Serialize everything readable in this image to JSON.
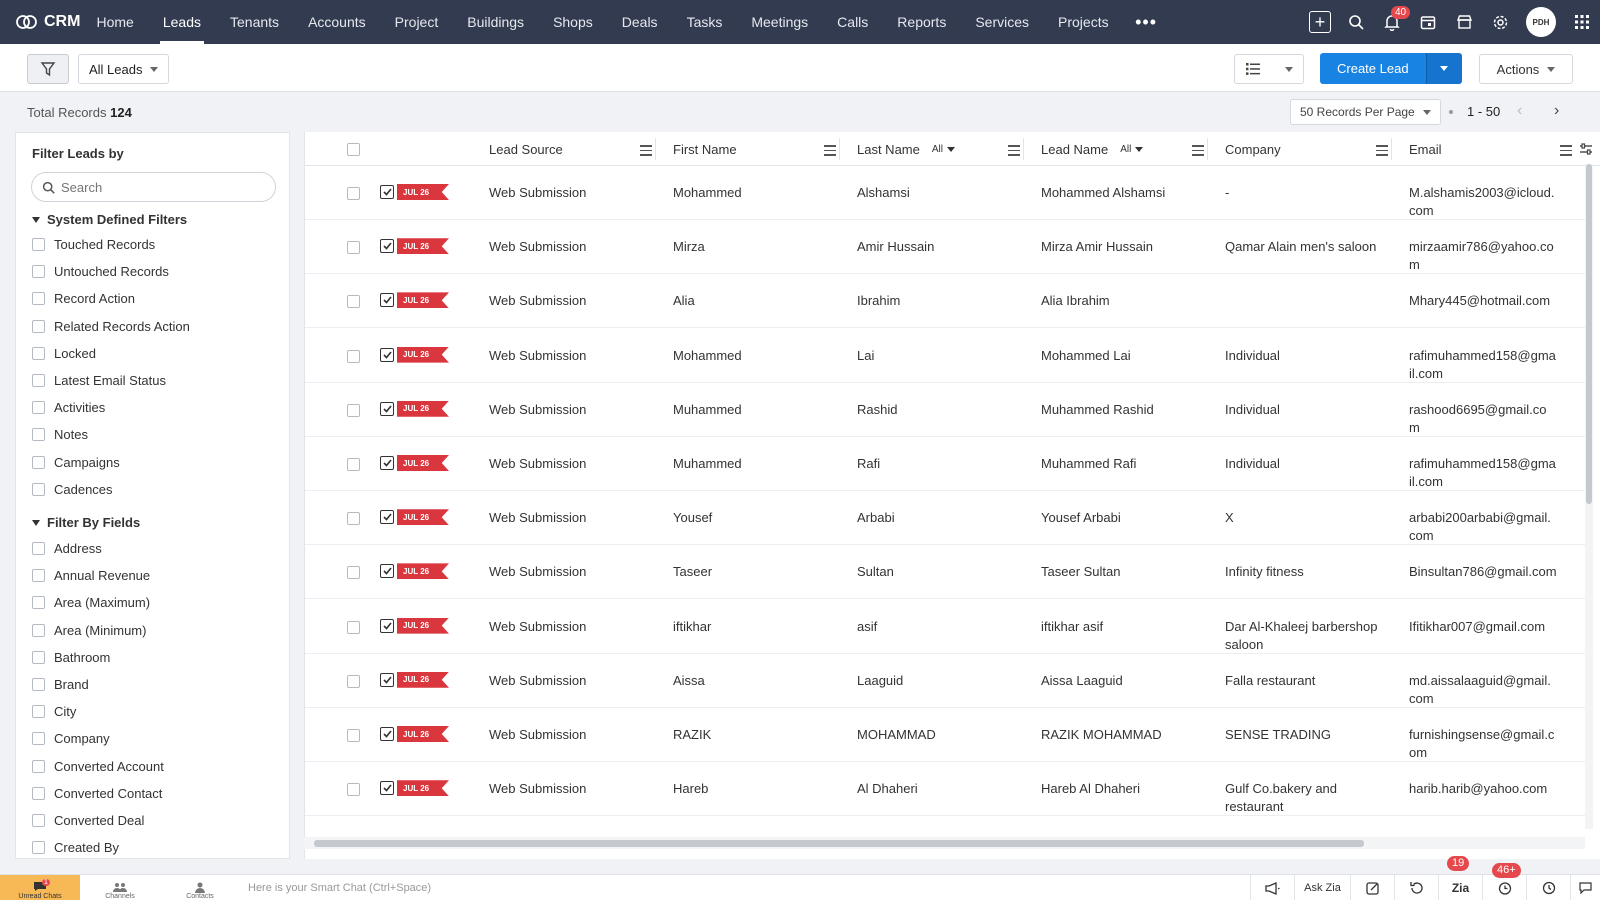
{
  "app": {
    "name": "CRM"
  },
  "nav": {
    "items": [
      "Home",
      "Leads",
      "Tenants",
      "Accounts",
      "Project",
      "Buildings",
      "Shops",
      "Deals",
      "Tasks",
      "Meetings",
      "Calls",
      "Reports",
      "Services",
      "Projects"
    ],
    "active": "Leads",
    "more": "•••",
    "notifications_count": "40",
    "avatar_text": "PDH"
  },
  "toolbar": {
    "view": "All Leads",
    "create_label": "Create Lead",
    "actions_label": "Actions"
  },
  "subbar": {
    "total_label": "Total Records",
    "total_count": "124",
    "per_page": "50 Records Per Page",
    "range": "1 - 50"
  },
  "sidebar": {
    "title": "Filter Leads by",
    "search_placeholder": "Search",
    "system_title": "System Defined Filters",
    "system_filters": [
      "Touched Records",
      "Untouched Records",
      "Record Action",
      "Related Records Action",
      "Locked",
      "Latest Email Status",
      "Activities",
      "Notes",
      "Campaigns",
      "Cadences"
    ],
    "fields_title": "Filter By Fields",
    "field_filters": [
      "Address",
      "Annual Revenue",
      "Area (Maximum)",
      "Area (Minimum)",
      "Bathroom",
      "Brand",
      "City",
      "Company",
      "Converted Account",
      "Converted Contact",
      "Converted Deal",
      "Created By"
    ]
  },
  "table": {
    "columns": {
      "lead_source": "Lead Source",
      "first_name": "First Name",
      "last_name": "Last Name",
      "lead_name": "Lead Name",
      "company": "Company",
      "email": "Email",
      "all_filter": "All"
    },
    "tag_label": "JUL 26",
    "rows": [
      {
        "source": "Web Submission",
        "first": "Mohammed",
        "last": "Alshamsi",
        "name": "Mohammed Alshamsi",
        "company": "-",
        "email": "M.alshamis2003@icloud.com"
      },
      {
        "source": "Web Submission",
        "first": "Mirza",
        "last": "Amir Hussain",
        "name": "Mirza Amir Hussain",
        "company": "Qamar Alain men's saloon",
        "email": "mirzaamir786@yahoo.com"
      },
      {
        "source": "Web Submission",
        "first": "Alia",
        "last": "Ibrahim",
        "name": "Alia Ibrahim",
        "company": "",
        "email": "Mhary445@hotmail.com"
      },
      {
        "source": "Web Submission",
        "first": "Mohammed",
        "last": "Lai",
        "name": "Mohammed Lai",
        "company": "Individual",
        "email": "rafimuhammed158@gmail.com"
      },
      {
        "source": "Web Submission",
        "first": "Muhammed",
        "last": "Rashid",
        "name": "Muhammed Rashid",
        "company": "Individual",
        "email": "rashood6695@gmail.com"
      },
      {
        "source": "Web Submission",
        "first": "Muhammed",
        "last": "Rafi",
        "name": "Muhammed Rafi",
        "company": "Individual",
        "email": "rafimuhammed158@gmail.com"
      },
      {
        "source": "Web Submission",
        "first": "Yousef",
        "last": "Arbabi",
        "name": "Yousef Arbabi",
        "company": "X",
        "email": "arbabi200arbabi@gmail.com"
      },
      {
        "source": "Web Submission",
        "first": "Taseer",
        "last": "Sultan",
        "name": "Taseer Sultan",
        "company": "Infinity fitness",
        "email": "Binsultan786@gmail.com"
      },
      {
        "source": "Web Submission",
        "first": "iftikhar",
        "last": "asif",
        "name": "iftikhar asif",
        "company": "Dar Al-Khaleej barbershop saloon",
        "email": "Ifitikhar007@gmail.com"
      },
      {
        "source": "Web Submission",
        "first": "Aissa",
        "last": "Laaguid",
        "name": "Aissa Laaguid",
        "company": "Falla restaurant",
        "email": "md.aissalaaguid@gmail.com"
      },
      {
        "source": "Web Submission",
        "first": "RAZIK",
        "last": "MOHAMMAD",
        "name": "RAZIK MOHAMMAD",
        "company": "SENSE TRADING",
        "email": "furnishingsense@gmail.com"
      },
      {
        "source": "Web Submission",
        "first": "Hareb",
        "last": "Al Dhaheri",
        "name": "Hareb Al Dhaheri",
        "company": "Gulf Co.bakery and restaurant",
        "email": "harib.harib@yahoo.com"
      }
    ]
  },
  "bottombar": {
    "unread_label": "Unread Chats",
    "unread_count": "1",
    "channels_label": "Channels",
    "contacts_label": "Contacts",
    "smart_chat": "Here is your Smart Chat (Ctrl+Space)",
    "ask_zia": "Ask Zia",
    "badge_a": "19",
    "badge_b": "46+"
  },
  "colors": {
    "topnav": "#323b4f",
    "primary": "#1983e4",
    "tag": "#d9363e",
    "badge": "#e5484d"
  }
}
